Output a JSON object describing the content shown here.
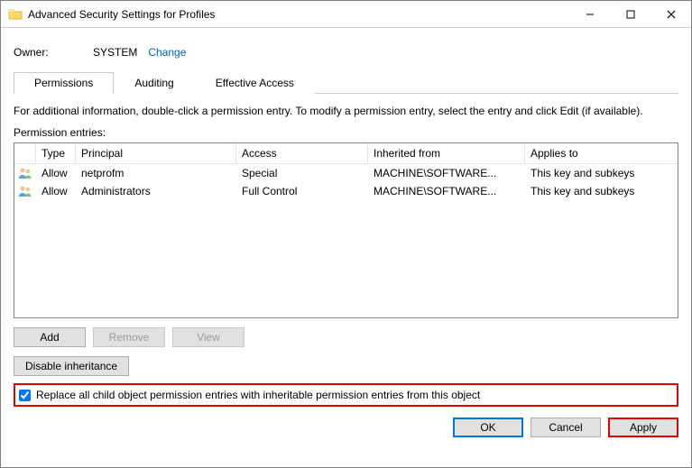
{
  "titlebar": {
    "title": "Advanced Security Settings for Profiles"
  },
  "owner": {
    "label": "Owner:",
    "value": "SYSTEM",
    "change": "Change"
  },
  "tabs": {
    "permissions": "Permissions",
    "auditing": "Auditing",
    "effective": "Effective Access"
  },
  "instruction": "For additional information, double-click a permission entry. To modify a permission entry, select the entry and click Edit (if available).",
  "perm_label": "Permission entries:",
  "columns": {
    "type": "Type",
    "principal": "Principal",
    "access": "Access",
    "inherited": "Inherited from",
    "applies": "Applies to"
  },
  "rows": [
    {
      "type": "Allow",
      "principal": "netprofm",
      "access": "Special",
      "inherited": "MACHINE\\SOFTWARE...",
      "applies": "This key and subkeys"
    },
    {
      "type": "Allow",
      "principal": "Administrators",
      "access": "Full Control",
      "inherited": "MACHINE\\SOFTWARE...",
      "applies": "This key and subkeys"
    }
  ],
  "buttons": {
    "add": "Add",
    "remove": "Remove",
    "view": "View",
    "disable": "Disable inheritance"
  },
  "replace_label": "Replace all child object permission entries with inheritable permission entries from this object",
  "footer": {
    "ok": "OK",
    "cancel": "Cancel",
    "apply": "Apply"
  }
}
